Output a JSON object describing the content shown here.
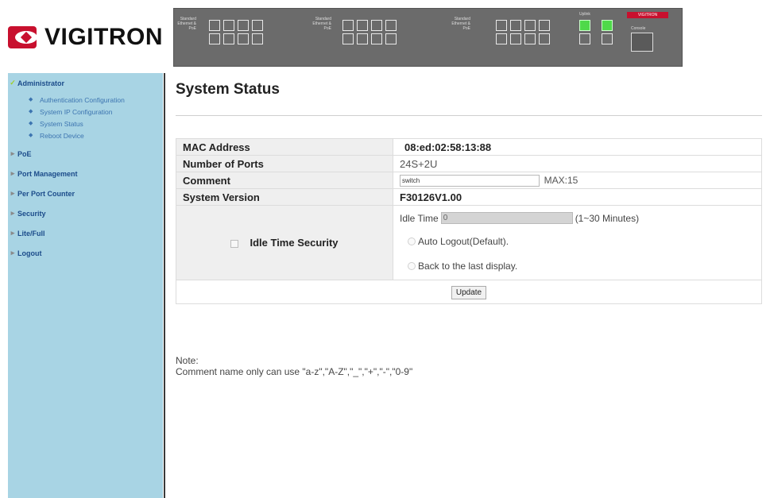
{
  "brand": {
    "name": "VIGITRON",
    "logo_color": "#c8102e"
  },
  "banner": {
    "group_label": "Standard Ethernet & PoE",
    "chip": "VIGITRON",
    "uplink_label": "Uplink",
    "console_label": "Console"
  },
  "sidebar": {
    "items": [
      {
        "label": "Administrator",
        "expanded": true,
        "sub": [
          {
            "label": "Authentication Configuration"
          },
          {
            "label": "System IP Configuration"
          },
          {
            "label": "System Status"
          },
          {
            "label": "Reboot Device"
          }
        ]
      },
      {
        "label": "PoE"
      },
      {
        "label": "Port Management"
      },
      {
        "label": "Per Port Counter"
      },
      {
        "label": "Security"
      },
      {
        "label": "Lite/Full"
      },
      {
        "label": "Logout"
      }
    ]
  },
  "main": {
    "title": "System Status",
    "rows": {
      "mac_label": "MAC Address",
      "mac_value": "08:ed:02:58:13:88",
      "ports_label": "Number of Ports",
      "ports_value": "24S+2U",
      "comment_label": "Comment",
      "comment_value": "switch",
      "comment_max": "MAX:15",
      "version_label": "System Version",
      "version_value": "F30126V1.00",
      "idle_label": "Idle Time Security",
      "idle_time_label": "Idle Time",
      "idle_time_value": "0",
      "idle_time_range": "(1~30 Minutes)",
      "radio_1": "Auto Logout(Default).",
      "radio_2": "Back to the last display."
    },
    "update_button": "Update",
    "note_title": "Note:",
    "note_text": "Comment name only can use \"a-z\",\"A-Z\",\"_\",\"+\",\"-\",\"0-9\""
  }
}
